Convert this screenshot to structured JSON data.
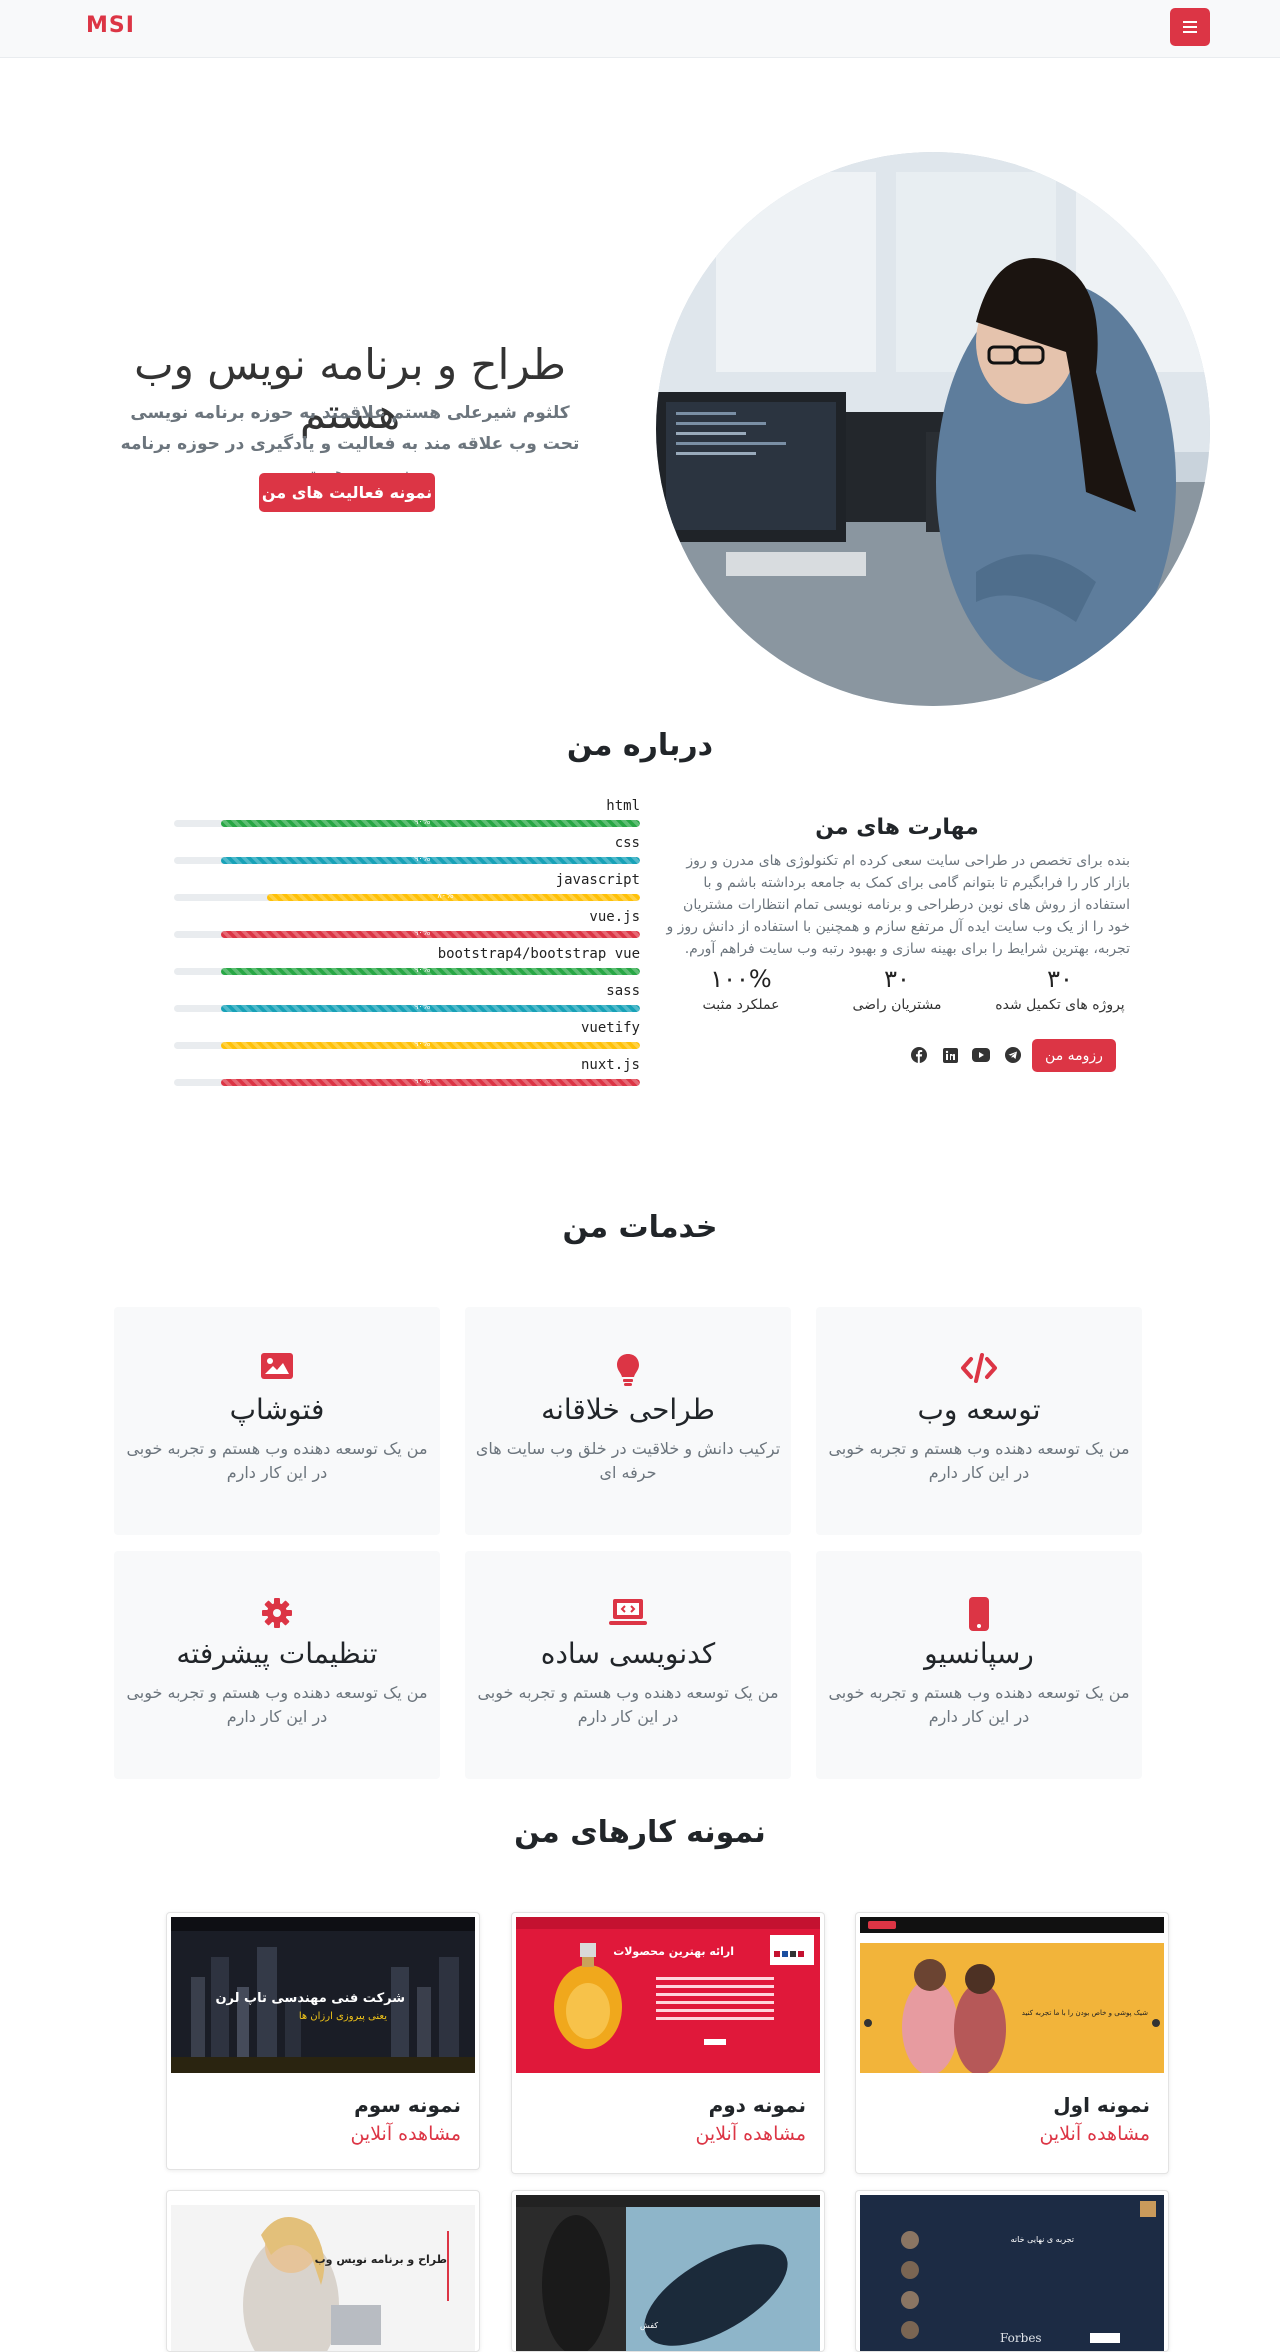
{
  "navbar": {
    "brand": "MSI",
    "menu_icon": "bars-icon"
  },
  "hero": {
    "title": "طراح و برنامه نویس وب هستم",
    "subtitle": "کلثوم شیرعلی هستم علاقمند به حوزه برنامه نویسی تحت وب علاقه مند به فعالیت و یادگیری در حوزه برنامه نویسی هستم.",
    "button": "نمونه فعالیت های من"
  },
  "about": {
    "heading": "درباره من",
    "skills_title": "مهارت های من",
    "description": "بنده برای تخصص در طراحی سایت سعی کرده ام تکنولوژی های مدرن و روز بازار کار را فرابگیرم تا بتوانم گامی برای کمک به جامعه برداشته باشم و با استفاده از روش های نوین درطراحی و برنامه نویسی تمام انتظارات مشتریان خود را از یک وب سایت ایده آل مرتفع سازم و همچنین با استفاده از دانش روز و تجربه، بهترین شرایط را برای بهینه سازی و بهبود رتبه وب سایت فراهم آورم.",
    "stats": [
      {
        "num": "۳۰",
        "label": "پروژه های تکمیل شده"
      },
      {
        "num": "۳۰",
        "label": "مشتریان راضی"
      },
      {
        "num": "۱۰۰%",
        "label": "عملکرد مثبت"
      }
    ],
    "resume_button": "رزومه من",
    "social_icons": [
      "telegram-icon",
      "youtube-icon",
      "linkedin-icon",
      "facebook-icon"
    ]
  },
  "skills": [
    {
      "name": "html",
      "value": 90,
      "label": "۹۰%",
      "color": "#28a745"
    },
    {
      "name": "css",
      "value": 90,
      "label": "۹۰%",
      "color": "#17a2b8"
    },
    {
      "name": "javascript",
      "value": 80,
      "label": "۸۰%",
      "color": "#ffc107"
    },
    {
      "name": "vue.js",
      "value": 90,
      "label": "۹۰%",
      "color": "#dc3545"
    },
    {
      "name": "bootstrap4/bootstrap vue",
      "value": 90,
      "label": "۹۰%",
      "color": "#28a745"
    },
    {
      "name": "sass",
      "value": 90,
      "label": "۹۰%",
      "color": "#17a2b8"
    },
    {
      "name": "vuetify",
      "value": 90,
      "label": "۹۰%",
      "color": "#ffc107"
    },
    {
      "name": "nuxt.js",
      "value": 90,
      "label": "۹۰%",
      "color": "#dc3545"
    }
  ],
  "services": {
    "heading": "خدمات من",
    "items": [
      {
        "icon": "code-icon",
        "title": "توسعه وب",
        "text": "من یک توسعه دهنده وب هستم و تجربه خوبی در این کار دارم"
      },
      {
        "icon": "lightbulb-icon",
        "title": "طراحی خلاقانه",
        "text": "ترکیب دانش و خلاقیت در خلق وب سایت های حرفه ای"
      },
      {
        "icon": "image-icon",
        "title": "فتوشاپ",
        "text": "من یک توسعه دهنده وب هستم و تجربه خوبی در این کار دارم"
      },
      {
        "icon": "mobile-icon",
        "title": "رسپانسیو",
        "text": "من یک توسعه دهنده وب هستم و تجربه خوبی در این کار دارم"
      },
      {
        "icon": "laptop-code-icon",
        "title": "کدنویسی ساده",
        "text": "من یک توسعه دهنده وب هستم و تجربه خوبی در این کار دارم"
      },
      {
        "icon": "gear-icon",
        "title": "تنظیمات پیشرفته",
        "text": "من یک توسعه دهنده وب هستم و تجربه خوبی در این کار دارم"
      }
    ]
  },
  "portfolio": {
    "heading": "نمونه کارهای من",
    "link_label": "مشاهده آنلاین",
    "items": [
      {
        "title": "نمونه اول",
        "thumb_text": "شیک پوشی و خاص بودن را با ما تجربه کنید"
      },
      {
        "title": "نمونه دوم",
        "thumb_text": "ارائه بهترین محصولات"
      },
      {
        "title": "نمونه سوم",
        "thumb_text": "شرکت فنی مهندسی تاپ لرن",
        "thumb_sub": "یعنی پیروزی ارزان ها"
      }
    ],
    "row2_thumbs": [
      {
        "thumb_text": "تجربه ی نهایی خانه",
        "thumb_sub": "Forbes"
      },
      {
        "thumb_text": "کفش"
      },
      {
        "thumb_text": "طراح و برنامه نویس وب"
      }
    ]
  },
  "colors": {
    "accent": "#dc3545",
    "light_bg": "#f8f9fa"
  }
}
